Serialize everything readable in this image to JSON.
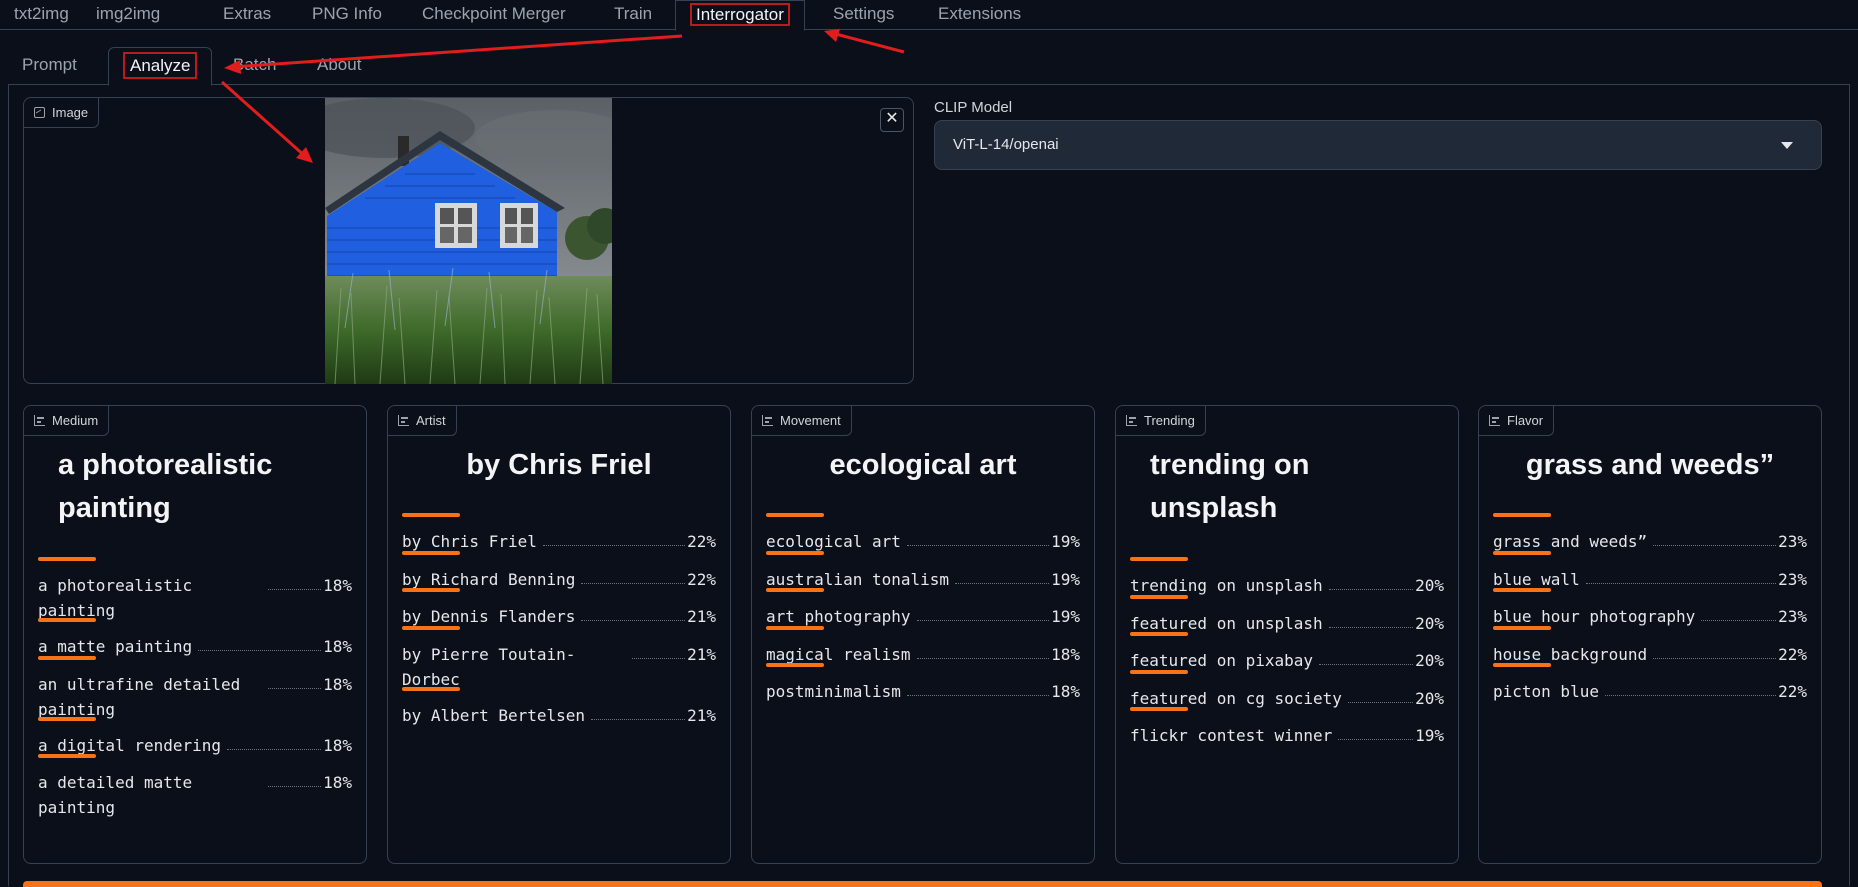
{
  "top_tabs": [
    "txt2img",
    "img2img",
    "Extras",
    "PNG Info",
    "Checkpoint Merger",
    "Train",
    "Interrogator",
    "Settings",
    "Extensions"
  ],
  "sub_tabs": [
    "Prompt",
    "Analyze",
    "Batch",
    "About"
  ],
  "image_block": {
    "label": "Image",
    "close_symbol": "✕"
  },
  "clip": {
    "label": "CLIP Model",
    "value": "ViT-L-14/openai"
  },
  "cards": [
    {
      "label": "Medium",
      "title": "a photorealistic painting",
      "items": [
        {
          "name": "a photorealistic painting",
          "pct": "18%"
        },
        {
          "name": "a matte painting",
          "pct": "18%"
        },
        {
          "name": "an ultrafine detailed painting",
          "pct": "18%"
        },
        {
          "name": "a digital rendering",
          "pct": "18%"
        },
        {
          "name": "a detailed matte painting",
          "pct": "18%"
        }
      ]
    },
    {
      "label": "Artist",
      "title": "by Chris Friel",
      "items": [
        {
          "name": "by Chris Friel",
          "pct": "22%"
        },
        {
          "name": "by Richard Benning",
          "pct": "22%"
        },
        {
          "name": "by Dennis Flanders",
          "pct": "21%"
        },
        {
          "name": "by Pierre Toutain-Dorbec",
          "pct": "21%"
        },
        {
          "name": "by Albert Bertelsen",
          "pct": "21%"
        }
      ]
    },
    {
      "label": "Movement",
      "title": "ecological art",
      "items": [
        {
          "name": "ecological art",
          "pct": "19%"
        },
        {
          "name": "australian tonalism",
          "pct": "19%"
        },
        {
          "name": "art photography",
          "pct": "19%"
        },
        {
          "name": "magical realism",
          "pct": "18%"
        },
        {
          "name": "postminimalism",
          "pct": "18%"
        }
      ]
    },
    {
      "label": "Trending",
      "title": "trending on unsplash",
      "items": [
        {
          "name": "trending on unsplash",
          "pct": "20%"
        },
        {
          "name": "featured on unsplash",
          "pct": "20%"
        },
        {
          "name": "featured on pixabay",
          "pct": "20%"
        },
        {
          "name": "featured on cg society",
          "pct": "20%"
        },
        {
          "name": "flickr contest winner",
          "pct": "19%"
        }
      ]
    },
    {
      "label": "Flavor",
      "title": "grass and weeds”",
      "items": [
        {
          "name": "grass and weeds”",
          "pct": "23%"
        },
        {
          "name": "blue wall",
          "pct": "23%"
        },
        {
          "name": "blue hour photography",
          "pct": "23%"
        },
        {
          "name": "house background",
          "pct": "22%"
        },
        {
          "name": "picton blue",
          "pct": "22%"
        }
      ]
    }
  ],
  "colors": {
    "background": "#0b0f19",
    "accent": "#f97316",
    "highlight_box": "#b91c1c",
    "annotation_arrow": "#e11d1d"
  },
  "icons": {
    "image_label": "image-icon",
    "card_label": "bar-chart-icon",
    "close": "close-icon",
    "dropdown": "chevron-down-icon"
  }
}
